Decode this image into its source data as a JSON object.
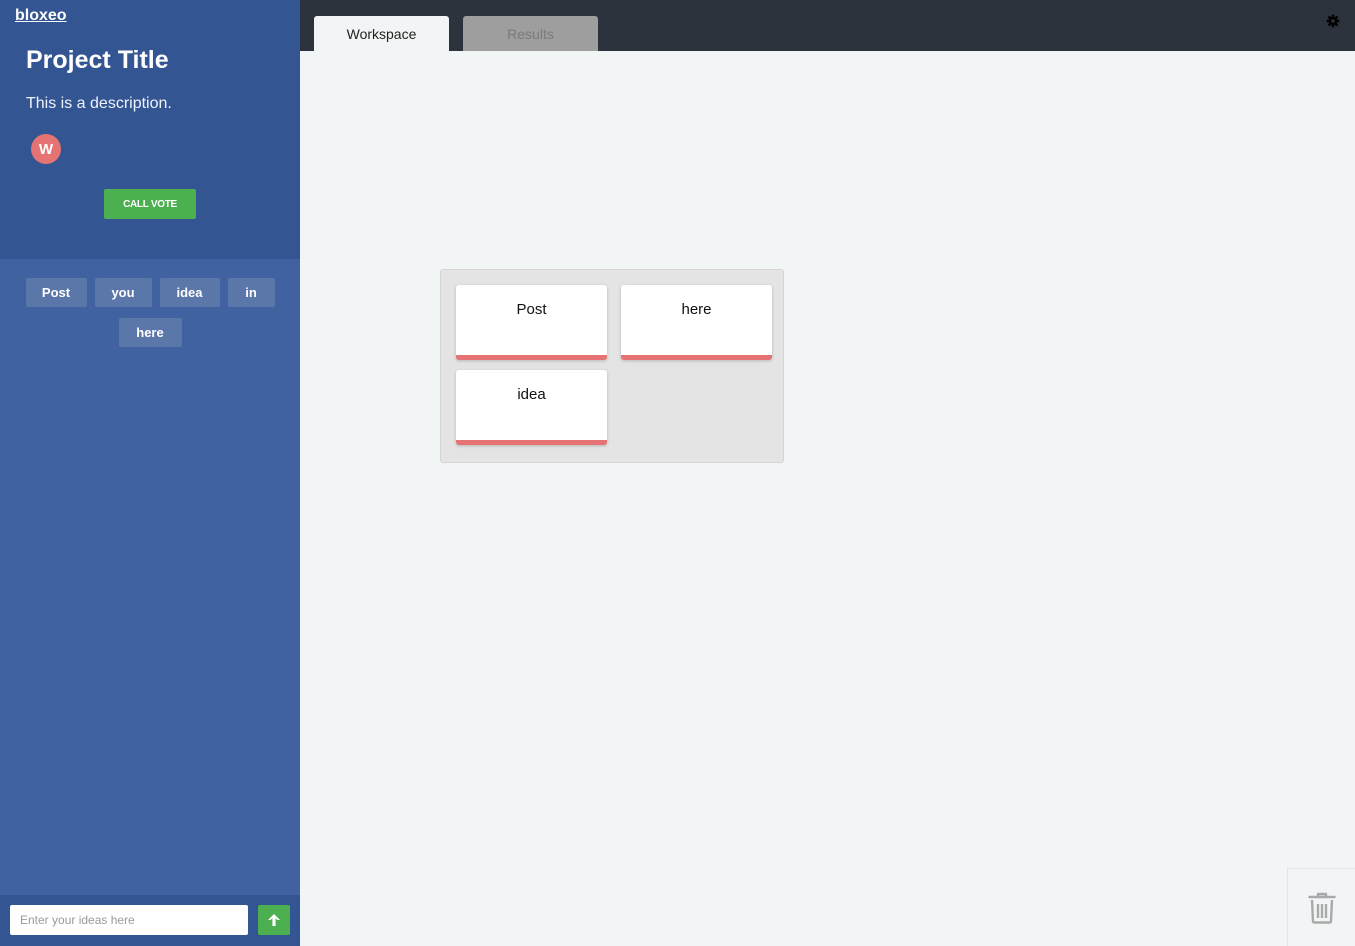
{
  "app": {
    "brand": "bloxeo"
  },
  "sidebar": {
    "project_title": "Project Title",
    "project_description": "This is a description.",
    "members": [
      {
        "initial": "W",
        "color": "#e57373"
      }
    ],
    "call_vote_label": "CALL VOTE",
    "word_chips": [
      "Post",
      "you",
      "idea",
      "in",
      "here"
    ],
    "input": {
      "placeholder": "Enter your ideas here",
      "value": ""
    },
    "submit_icon": "arrow-up-icon",
    "toggle_icon": "chevron-right-icon"
  },
  "topbar": {
    "tabs": [
      {
        "label": "Workspace",
        "active": true
      },
      {
        "label": "Results",
        "active": false
      }
    ],
    "settings_icon": "gear-icon"
  },
  "workspace": {
    "groups": [
      {
        "cards": [
          {
            "text": "Post"
          },
          {
            "text": "here"
          },
          {
            "text": "idea"
          }
        ]
      }
    ],
    "trash_icon": "trash-icon"
  },
  "colors": {
    "sidebar_dark": "#335592",
    "sidebar_light": "#4162a0",
    "accent_green": "#4caf50",
    "card_accent": "#e57373",
    "topbar": "#2d333c",
    "workspace_bg": "#f1f5f5"
  }
}
